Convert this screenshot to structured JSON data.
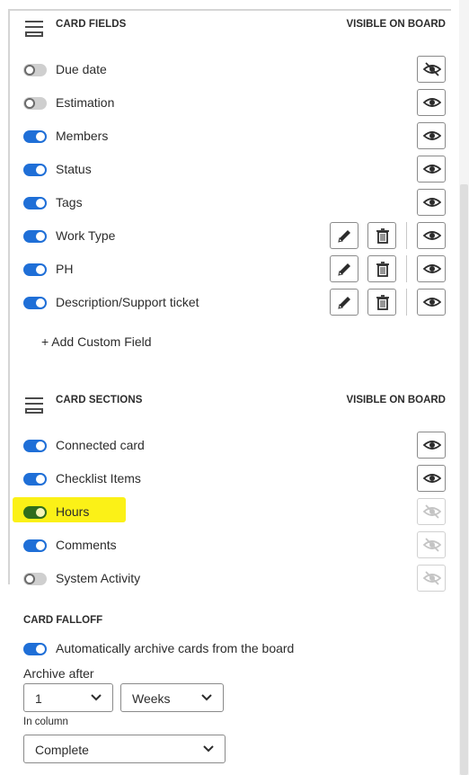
{
  "card_fields": {
    "title": "CARD FIELDS",
    "right_label": "VISIBLE ON BOARD",
    "items": [
      {
        "label": "Due date",
        "enabled": false,
        "visible": false,
        "editable": false
      },
      {
        "label": "Estimation",
        "enabled": false,
        "visible": true,
        "editable": false
      },
      {
        "label": "Members",
        "enabled": true,
        "visible": true,
        "editable": false
      },
      {
        "label": "Status",
        "enabled": true,
        "visible": true,
        "editable": false
      },
      {
        "label": "Tags",
        "enabled": true,
        "visible": true,
        "editable": false
      },
      {
        "label": "Work Type",
        "enabled": true,
        "visible": true,
        "editable": true
      },
      {
        "label": "PH",
        "enabled": true,
        "visible": true,
        "editable": true
      },
      {
        "label": "Description/Support ticket",
        "enabled": true,
        "visible": true,
        "editable": true
      }
    ],
    "add_custom_field": "+ Add Custom Field"
  },
  "card_sections": {
    "title": "CARD SECTIONS",
    "right_label": "VISIBLE ON BOARD",
    "items": [
      {
        "label": "Connected card",
        "enabled": true,
        "visible": true,
        "disabled": false
      },
      {
        "label": "Checklist Items",
        "enabled": true,
        "visible": true,
        "disabled": false
      },
      {
        "label": "Hours",
        "enabled": true,
        "visible": false,
        "disabled": true,
        "highlighted": true
      },
      {
        "label": "Comments",
        "enabled": true,
        "visible": false,
        "disabled": true
      },
      {
        "label": "System Activity",
        "enabled": false,
        "visible": false,
        "disabled": true
      }
    ]
  },
  "card_falloff": {
    "title": "CARD FALLOFF",
    "auto_archive_label": "Automatically archive cards from the board",
    "auto_archive_enabled": true,
    "archive_after_label": "Archive after",
    "archive_amount": "1",
    "archive_unit": "Weeks",
    "in_column_label": "In column",
    "in_column_value": "Complete"
  },
  "colors": {
    "toggle_on": "#1f6fd7",
    "toggle_off": "#cfcfcf",
    "highlight": "#fbf117"
  }
}
